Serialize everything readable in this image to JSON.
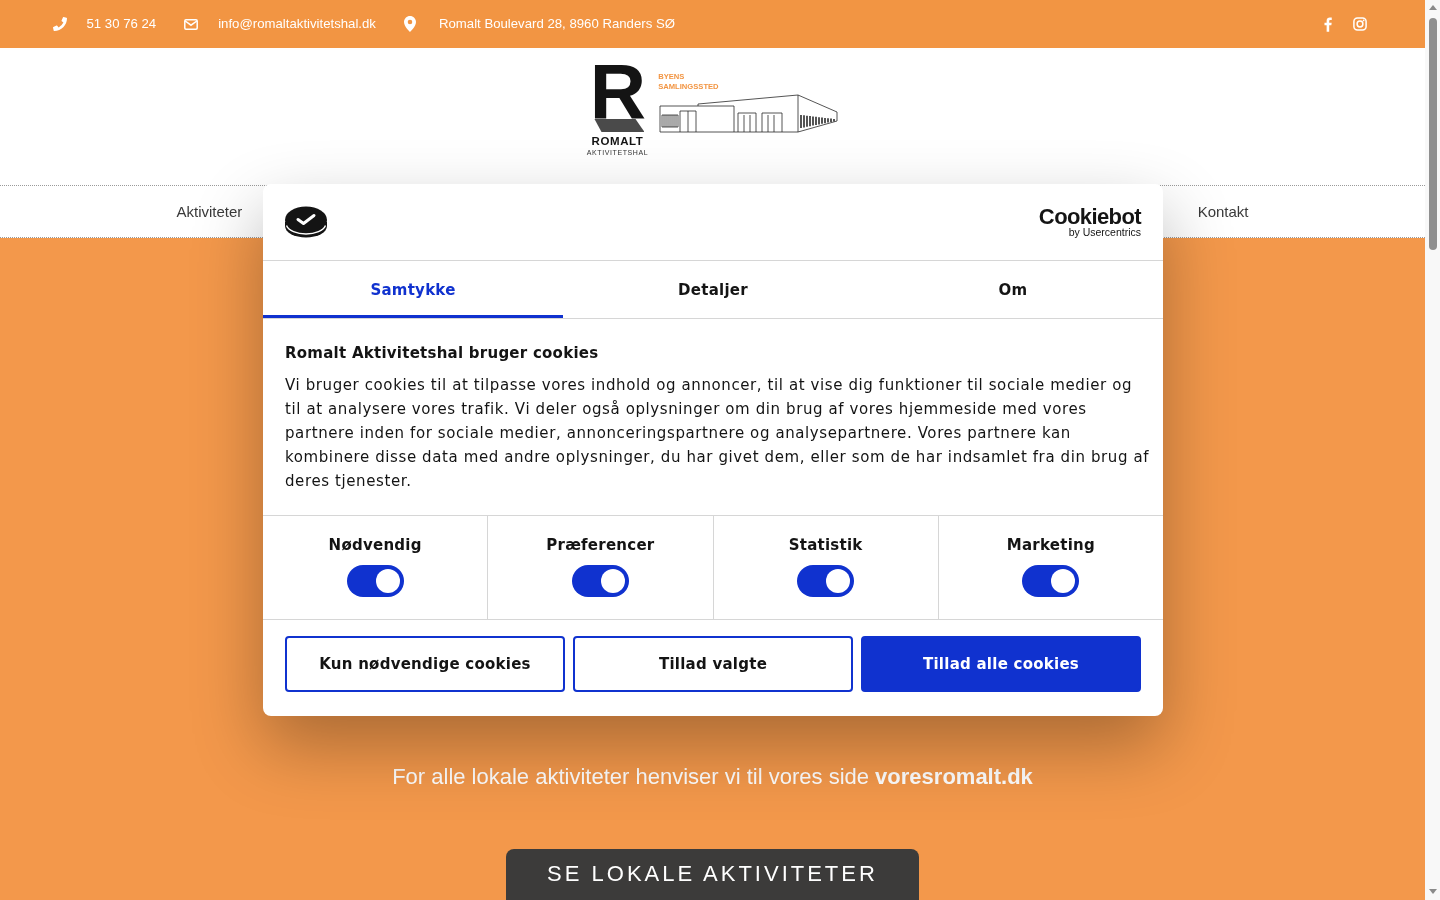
{
  "top_bar": {
    "contacts": [
      {
        "kind": "phone",
        "text": "51 30 76 24"
      },
      {
        "kind": "email",
        "text": "info@romaltaktivitetshal.dk"
      },
      {
        "kind": "address",
        "text": "Romalt Boulevard 28, 8960 Randers SØ"
      }
    ]
  },
  "logo": {
    "letter": "R",
    "name": "ROMALT",
    "subtitle": "AKTIVITETSHAL",
    "tagline": [
      "BYENS",
      "SAMLINGSSTED"
    ]
  },
  "nav": {
    "items": [
      "Aktiviteter",
      "Kontakt"
    ]
  },
  "cookie_dialog": {
    "brand": {
      "name": "Cookiebot",
      "byline": "by Usercentrics"
    },
    "tabs": [
      {
        "label": "Samtykke",
        "selected": true
      },
      {
        "label": "Detaljer",
        "selected": false
      },
      {
        "label": "Om",
        "selected": false
      }
    ],
    "title": "Romalt Aktivitetshal bruger cookies",
    "text": "Vi bruger cookies til at tilpasse vores indhold og annoncer, til at vise dig funktioner til sociale medier og til at analysere vores trafik. Vi deler også oplysninger om din brug af vores hjemmeside med vores partnere inden for sociale medier, annonceringspartnere og analysepartnere. Vores partnere kan kombinere disse data med andre oplysninger, du har givet dem, eller som de har indsamlet fra din brug af deres tjenester.",
    "categories": [
      {
        "label": "Nødvendig",
        "on": true
      },
      {
        "label": "Præferencer",
        "on": true
      },
      {
        "label": "Statistik",
        "on": true
      },
      {
        "label": "Marketing",
        "on": true
      }
    ],
    "buttons": [
      {
        "label": "Kun nødvendige cookies",
        "kind": "outline"
      },
      {
        "label": "Tillad valgte",
        "kind": "outline"
      },
      {
        "label": "Tillad alle cookies",
        "kind": "primary"
      }
    ]
  },
  "hero": {
    "text": "For alle lokale aktiviteter henviser vi til vores side",
    "link": "voresromalt.dk",
    "button": "SE LOKALE AKTIVITETER"
  }
}
